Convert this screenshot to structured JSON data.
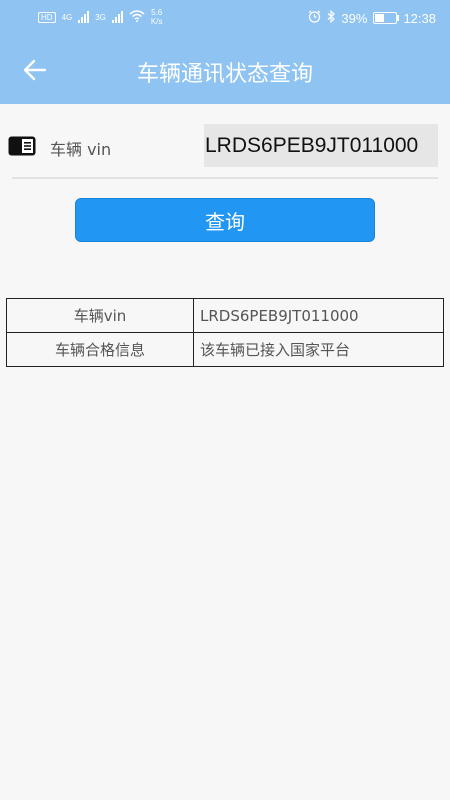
{
  "status_bar": {
    "hd": "HD",
    "net_4g": "4G",
    "net_3g": "3G",
    "speed_value": "5.6",
    "speed_unit": "K/s",
    "battery": "39%",
    "time": "12:38"
  },
  "header": {
    "title": "车辆通讯状态查询"
  },
  "form": {
    "vin_label": "车辆 vin",
    "vin_value": "LRDS6PEB9JT011000",
    "query_button": "查询"
  },
  "result": {
    "rows": [
      {
        "key": "车辆vin",
        "value": "LRDS6PEB9JT011000"
      },
      {
        "key": "车辆合格信息",
        "value": "该车辆已接入国家平台"
      }
    ]
  },
  "colors": {
    "header_bg": "#8fc3f1",
    "button_bg": "#2196f3",
    "page_bg": "#f7f7f7"
  }
}
